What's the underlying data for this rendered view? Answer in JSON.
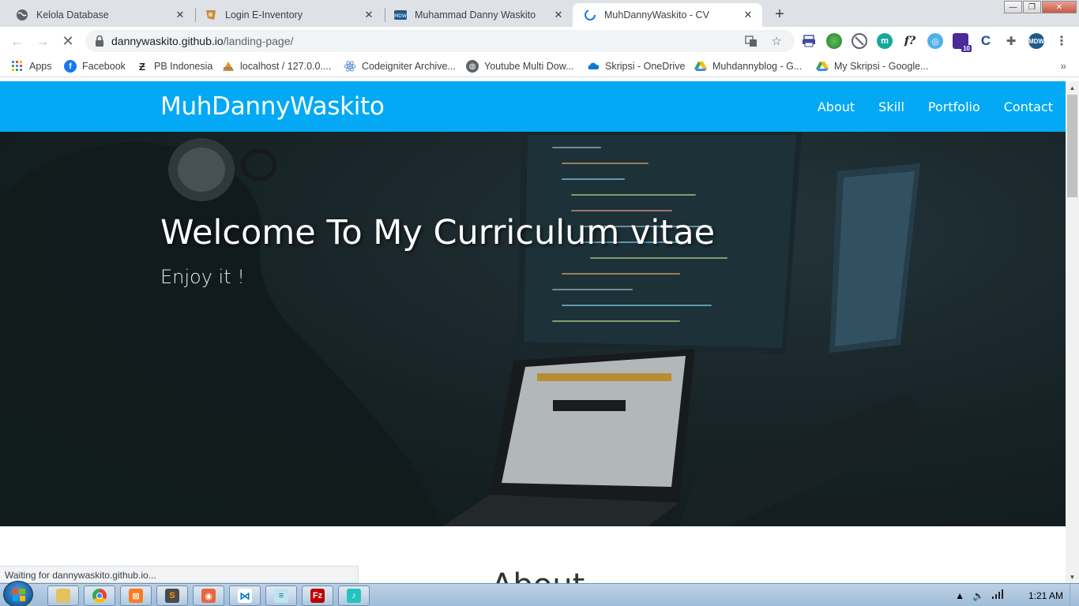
{
  "browser": {
    "tabs": [
      {
        "title": "Kelola Database",
        "favicon": "globe-icon",
        "active": false
      },
      {
        "title": "Login E-Inventory",
        "favicon": "pma-icon",
        "active": false
      },
      {
        "title": "Muhammad Danny Waskito",
        "favicon": "mdw-icon",
        "active": false
      },
      {
        "title": "MuhDannyWaskito - CV",
        "favicon": "loading-icon",
        "active": true
      }
    ],
    "new_tab_glyph": "+",
    "address": {
      "domain": "dannywaskito.github.io",
      "path": "/landing-page/"
    },
    "bookmarks": [
      {
        "label": "Apps",
        "icon": "apps-grid-icon"
      },
      {
        "label": "Facebook",
        "icon": "facebook-icon"
      },
      {
        "label": "PB Indonesia",
        "icon": "pb-icon"
      },
      {
        "label": "localhost / 127.0.0....",
        "icon": "phpmyadmin-icon"
      },
      {
        "label": "Codeigniter Archive...",
        "icon": "react-icon"
      },
      {
        "label": "Youtube Multi Dow...",
        "icon": "globe-icon"
      },
      {
        "label": "Skripsi - OneDrive",
        "icon": "onedrive-icon"
      },
      {
        "label": "Muhdannyblog - G...",
        "icon": "google-drive-icon"
      },
      {
        "label": "My Skripsi - Google...",
        "icon": "google-drive-icon"
      }
    ],
    "bookmarks_more": "»",
    "extension_badge": "10",
    "status_text": "Waiting for dannywaskito.github.io..."
  },
  "site": {
    "brand": "MuhDannyWaskito",
    "nav": [
      "About",
      "Skill",
      "Portfolio",
      "Contact"
    ],
    "hero_title": "Welcome To My Curriculum vitae",
    "hero_subtitle": "Enjoy it !",
    "section_title": "About",
    "nav_color": "#03a9f4"
  },
  "taskbar": {
    "clock": "1:21 AM"
  }
}
